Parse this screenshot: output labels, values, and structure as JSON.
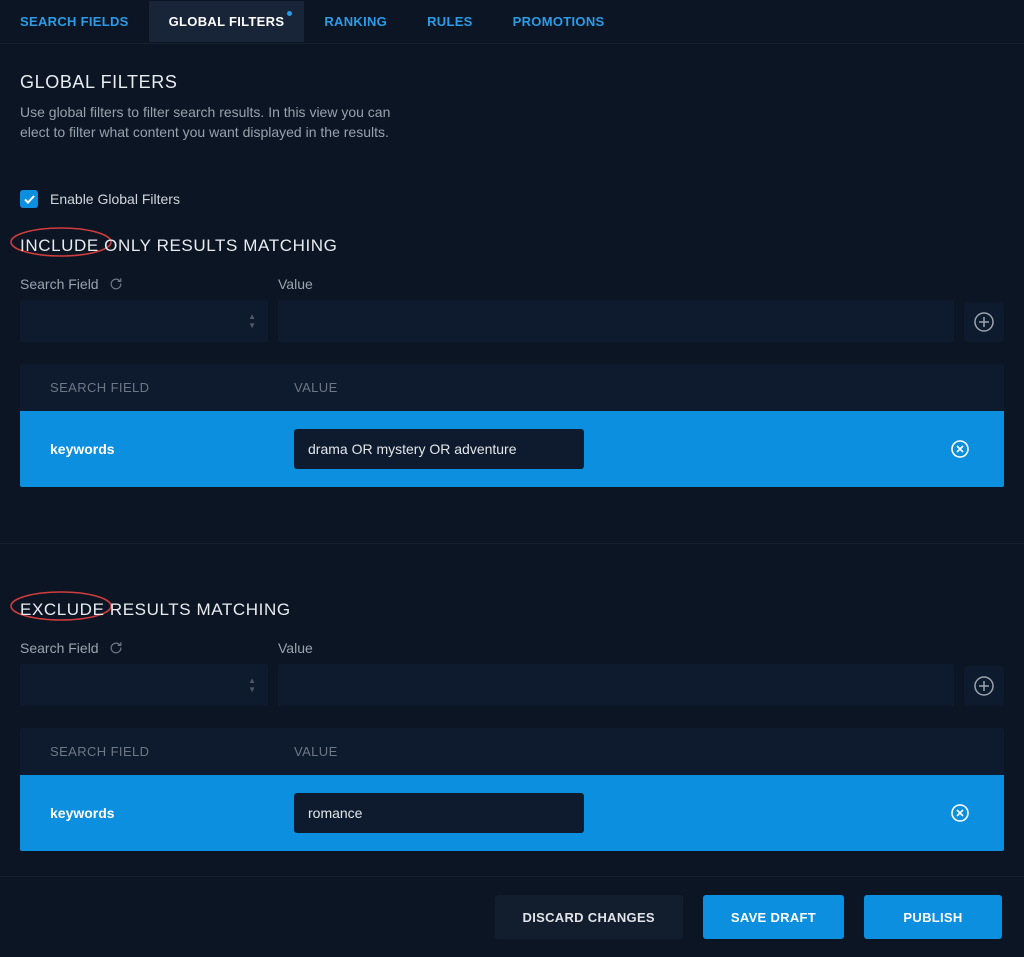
{
  "tabs": {
    "items": [
      {
        "label": "SEARCH FIELDS",
        "active": false
      },
      {
        "label": "GLOBAL FILTERS",
        "active": true,
        "indicator": true
      },
      {
        "label": "RANKING",
        "active": false
      },
      {
        "label": "RULES",
        "active": false
      },
      {
        "label": "PROMOTIONS",
        "active": false
      }
    ]
  },
  "header": {
    "title": "GLOBAL FILTERS",
    "description": "Use global filters to filter search results. In this view you can elect to filter what content you want displayed in the results."
  },
  "enable_toggle": {
    "checked": true,
    "label": "Enable Global Filters"
  },
  "include_section": {
    "title": "INCLUDE ONLY RESULTS MATCHING",
    "search_field_label": "Search Field",
    "value_label": "Value",
    "table": {
      "headers": {
        "field": "SEARCH FIELD",
        "value": "VALUE"
      },
      "rows": [
        {
          "field": "keywords",
          "value": "drama OR mystery OR adventure"
        }
      ]
    }
  },
  "exclude_section": {
    "title": "EXCLUDE RESULTS MATCHING",
    "search_field_label": "Search Field",
    "value_label": "Value",
    "table": {
      "headers": {
        "field": "SEARCH FIELD",
        "value": "VALUE"
      },
      "rows": [
        {
          "field": "keywords",
          "value": "romance"
        }
      ]
    }
  },
  "footer": {
    "discard": "DISCARD CHANGES",
    "save_draft": "SAVE DRAFT",
    "publish": "PUBLISH"
  },
  "colors": {
    "accent": "#0c8fde",
    "bg": "#0b1524",
    "panel": "#0e1b2e",
    "annotation": "#d13c3c"
  }
}
